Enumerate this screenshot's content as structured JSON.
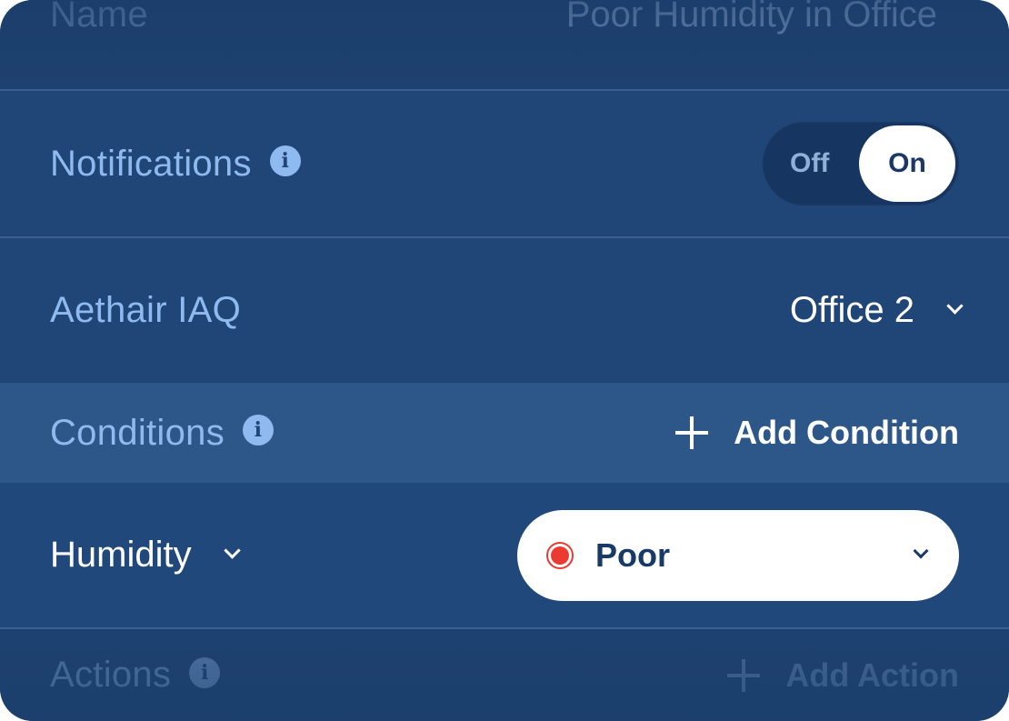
{
  "name_row": {
    "label": "Name",
    "value": "Poor Humidity in Office"
  },
  "notifications": {
    "label": "Notifications",
    "info_icon": "info-icon",
    "toggle": {
      "off_label": "Off",
      "on_label": "On",
      "selected": "On"
    }
  },
  "device": {
    "label": "Aethair IAQ",
    "selected_value": "Office 2"
  },
  "conditions": {
    "label": "Conditions",
    "info_icon": "info-icon",
    "add_label": "Add Condition",
    "items": [
      {
        "metric": "Humidity",
        "level": "Poor",
        "level_color": "#ec3a33"
      }
    ]
  },
  "actions": {
    "label": "Actions",
    "info_icon": "info-icon",
    "add_label": "Add Action"
  },
  "colors": {
    "panel_bg": "#1f4677",
    "label_blue": "#8fbaf0",
    "section_bg": "#2d5789",
    "status_poor": "#ec3a33"
  }
}
